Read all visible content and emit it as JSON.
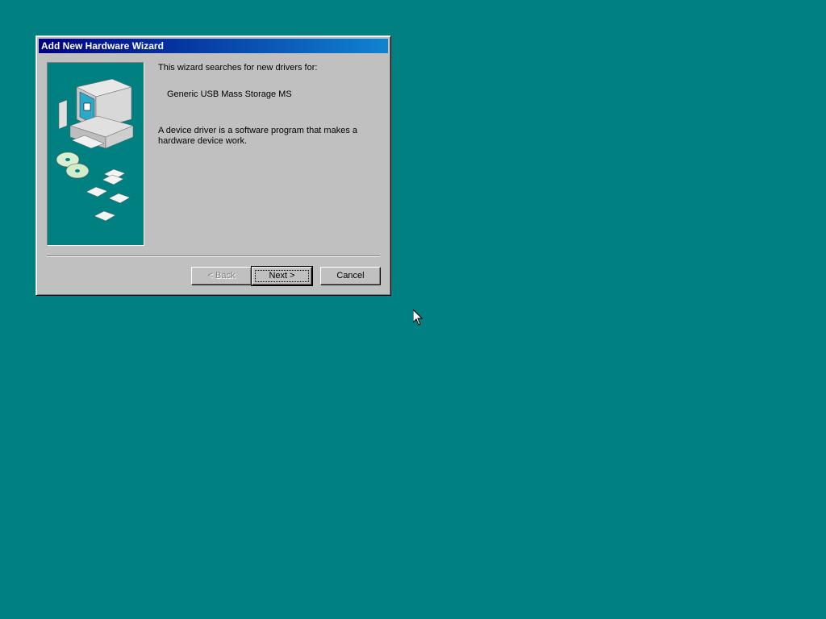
{
  "window": {
    "title": "Add New Hardware Wizard"
  },
  "content": {
    "intro": "This wizard searches for new drivers for:",
    "device_name": "Generic USB Mass Storage MS",
    "description_line1": "A device driver is a software program that makes a",
    "description_line2": "hardware device work."
  },
  "buttons": {
    "back": "< Back",
    "next": "Next >",
    "cancel": "Cancel"
  },
  "colors": {
    "desktop": "#008080",
    "titlebar_start": "#000080",
    "titlebar_end": "#1084d0",
    "window_face": "#c0c0c0"
  }
}
